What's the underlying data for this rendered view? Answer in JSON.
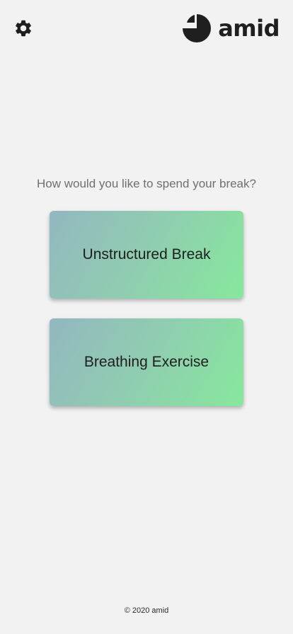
{
  "header": {
    "settings_icon": "gear-icon",
    "logo_icon": "pie-logo-icon",
    "logo_text": "amid"
  },
  "main": {
    "prompt": "How would you like to spend your break?",
    "options": [
      {
        "label": "Unstructured Break"
      },
      {
        "label": "Breathing Exercise"
      }
    ]
  },
  "footer": {
    "copyright": "© 2020 amid"
  },
  "colors": {
    "background": "#f2f2f2",
    "card_gradient_start": "#93b7c0",
    "card_gradient_end": "#86e89c",
    "text_dark": "#1e1e1e",
    "text_muted": "#6f6f6f"
  }
}
